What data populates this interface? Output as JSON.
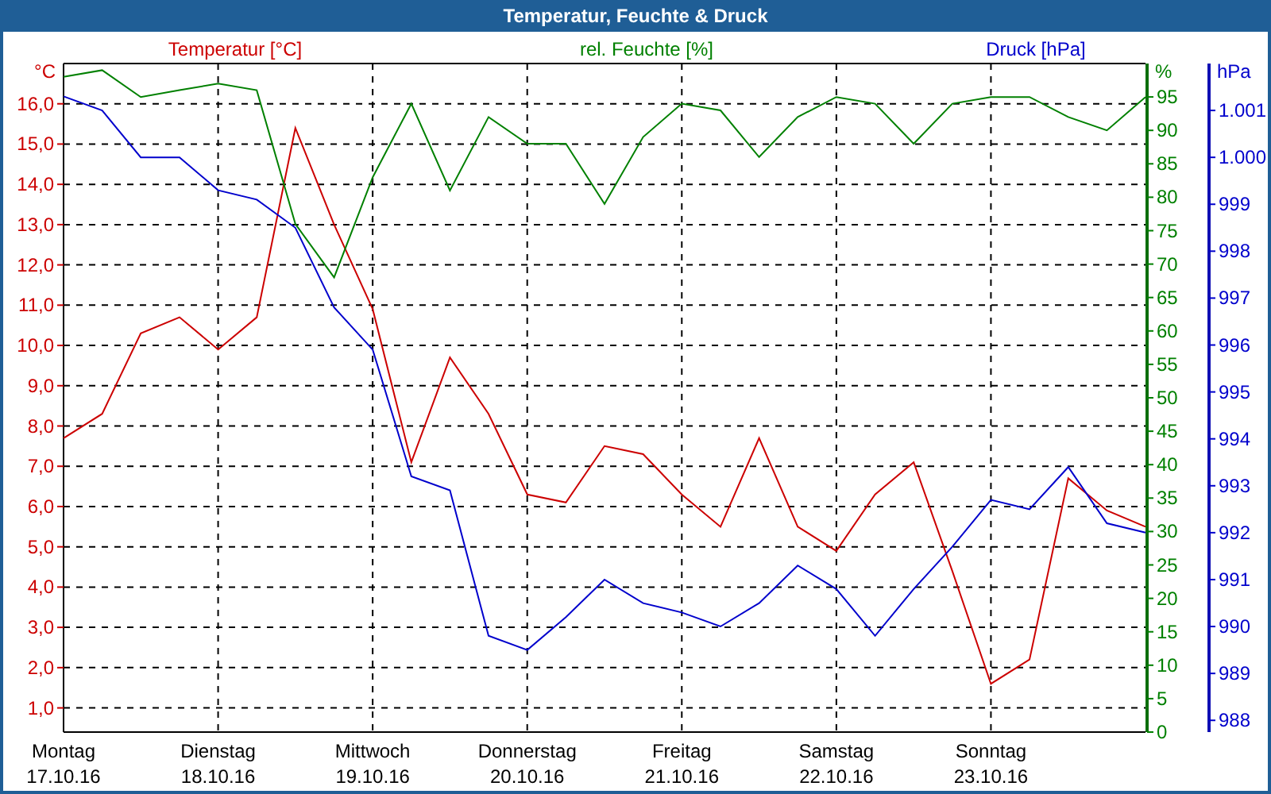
{
  "window": {
    "title": "Temperatur, Feuchte & Druck"
  },
  "charts": [
    {
      "chart_data": {
        "type": "line",
        "ylabel": "°C",
        "ylim": [
          0.4,
          17.0
        ],
        "categories": [
          "Montag\n17.10.16",
          null,
          null,
          null,
          "Dienstag\n18.10.16",
          null,
          null,
          null,
          "Mittwoch\n19.10.16",
          null,
          null,
          null,
          "Donnerstag\n20.10.16",
          null,
          null,
          null,
          "Freitag\n21.10.16",
          null,
          null,
          null,
          "Samstag\n22.10.16",
          null,
          null,
          null,
          "Sonntag\n23.10.16",
          null,
          null,
          null,
          null
        ],
        "yticks": [
          {
            "value": 1,
            "label": "1,0"
          },
          {
            "value": 2,
            "label": "2,0"
          },
          {
            "value": 3,
            "label": "3,0"
          },
          {
            "value": 4,
            "label": "4,0"
          },
          {
            "value": 5,
            "label": "5,0"
          },
          {
            "value": 6,
            "label": "6,0"
          },
          {
            "value": 7,
            "label": "7,0"
          },
          {
            "value": 8,
            "label": "8,0"
          },
          {
            "value": 9,
            "label": "9,0"
          },
          {
            "value": 10,
            "label": "10,0"
          },
          {
            "value": 11,
            "label": "11,0"
          },
          {
            "value": 12,
            "label": "12,0"
          },
          {
            "value": 13,
            "label": "13,0"
          },
          {
            "value": 14,
            "label": "14,0"
          },
          {
            "value": 15,
            "label": "15,0"
          },
          {
            "value": 16,
            "label": "16,0"
          }
        ],
        "series": [
          {
            "name": "Temperatur [°C]",
            "color": "#cc0000",
            "values": [
              7.7,
              8.3,
              10.3,
              10.7,
              9.9,
              10.7,
              15.4,
              13.0,
              10.9,
              7.1,
              9.7,
              8.3,
              6.3,
              6.1,
              7.5,
              7.3,
              6.3,
              5.5,
              7.7,
              5.5,
              4.9,
              6.3,
              7.1,
              4.4,
              1.6,
              2.2,
              6.7,
              5.9,
              5.5
            ]
          }
        ]
      }
    },
    {
      "chart_data": {
        "type": "line",
        "ylabel": "%",
        "ylim": [
          0,
          100
        ],
        "yticks": [
          0,
          5,
          10,
          15,
          20,
          25,
          30,
          35,
          40,
          45,
          50,
          55,
          60,
          65,
          70,
          75,
          80,
          85,
          90,
          95
        ],
        "series": [
          {
            "name": "rel. Feuchte [%]",
            "color": "#008000",
            "values": [
              98,
              99,
              95,
              96,
              97,
              96,
              76,
              68,
              83,
              94,
              81,
              92,
              88,
              88,
              79,
              89,
              94,
              93,
              86,
              92,
              95,
              94,
              88,
              94,
              95,
              95,
              92,
              90,
              95
            ]
          }
        ]
      }
    },
    {
      "chart_data": {
        "type": "line",
        "ylabel": "hPa",
        "ylim": [
          987.75,
          1002
        ],
        "yticks": [
          988,
          989,
          990,
          991,
          992,
          993,
          994,
          995,
          996,
          997,
          998,
          999,
          {
            "value": 1000,
            "label": "1.000"
          },
          {
            "value": 1001,
            "label": "1.001"
          }
        ],
        "series": [
          {
            "name": "Druck [hPa]",
            "color": "#0000cc",
            "values": [
              1001.3,
              1001.0,
              1000.0,
              1000.0,
              999.3,
              999.1,
              998.5,
              996.8,
              995.9,
              993.2,
              992.9,
              989.8,
              989.5,
              990.2,
              991.0,
              990.5,
              990.3,
              990.0,
              990.5,
              991.3,
              990.8,
              989.8,
              990.8,
              991.7,
              992.7,
              992.5,
              993.4,
              992.2,
              992.0
            ]
          }
        ]
      }
    }
  ]
}
